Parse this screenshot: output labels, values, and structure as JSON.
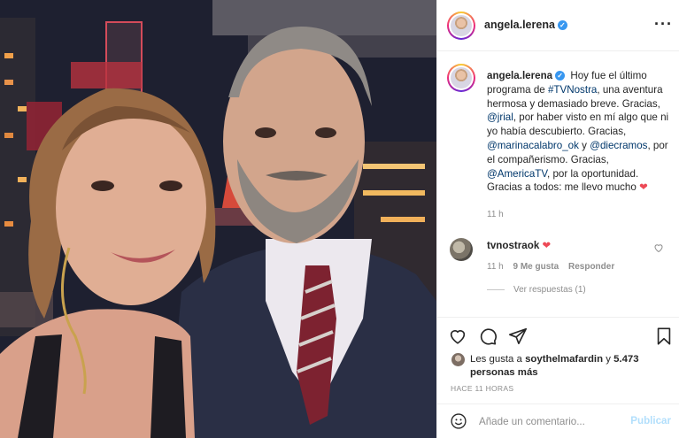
{
  "post": {
    "author": "angela.lerena",
    "more_icon": "more-dots-icon",
    "verified_icon": "verified-badge-icon"
  },
  "caption": {
    "username": "angela.lerena",
    "parts": {
      "p1": "Hoy fue el último programa de ",
      "tag1": "#TVNostra",
      "p2": ", una aventura hermosa y demasiado breve. Gracias, ",
      "m1": "@jrial",
      "p3": ", por haber visto en mí algo que ni yo había descubierto. Gracias, ",
      "m2": "@marinacalabro_ok",
      "p4": " y ",
      "m3": "@diecramos",
      "p5": ", por el compañerismo. Gracias, ",
      "m4": "@AmericaTV",
      "p6": ", por la oportunidad. Gracias a todos: me llevo mucho ",
      "heart": "❤"
    },
    "time": "11 h"
  },
  "comment": {
    "username": "tvnostraok",
    "text": "❤",
    "time": "11 h",
    "likes": "9 Me gusta",
    "reply": "Responder",
    "view_replies": "Ver respuestas (1)"
  },
  "actions": {
    "icons": [
      "heart-icon",
      "comment-icon",
      "share-icon",
      "bookmark-icon"
    ]
  },
  "likes": {
    "prefix": "Les gusta a ",
    "user": "soythelmafardin",
    "middle": " y ",
    "count": "5.473 personas más"
  },
  "timestamp": "HACE 11 HORAS",
  "add_comment": {
    "placeholder": "Añade un comentario...",
    "publish": "Publicar"
  },
  "colors": {
    "link": "#00376b",
    "verified": "#3897f0",
    "heart": "#ed4956",
    "publish_disabled": "#b2dffc",
    "meta": "#8e8e8e"
  }
}
